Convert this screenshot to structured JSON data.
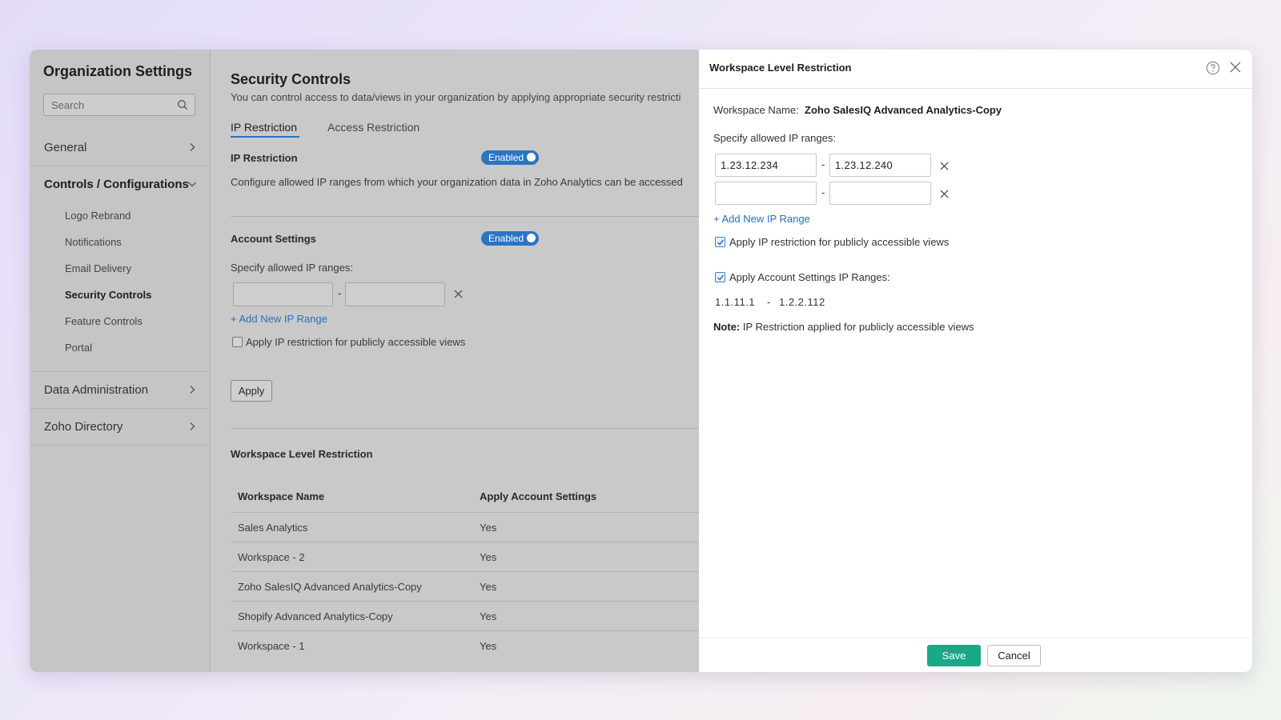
{
  "sidebar": {
    "title": "Organization Settings",
    "search_placeholder": "Search",
    "sections": {
      "general": "General",
      "controls": "Controls / Configurations",
      "data_admin": "Data Administration",
      "directory": "Zoho Directory"
    },
    "sub_items": [
      "Logo Rebrand",
      "Notifications",
      "Email Delivery",
      "Security Controls",
      "Feature Controls",
      "Portal"
    ],
    "active_sub_item": "Security Controls"
  },
  "main": {
    "title": "Security Controls",
    "description": "You can control access to data/views in your organization by applying appropriate security restricti",
    "tabs": [
      "IP Restriction",
      "Access Restriction"
    ],
    "active_tab": "IP Restriction",
    "ip_restriction": {
      "label": "IP Restriction",
      "toggle": "Enabled",
      "description": "Configure allowed IP ranges from which your organization data in Zoho Analytics can be accessed"
    },
    "account_settings": {
      "label": "Account Settings",
      "toggle": "Enabled",
      "ranges_label": "Specify allowed IP ranges:",
      "range_separator": "-",
      "add_link": "+ Add New IP Range",
      "public_views_checkbox": "Apply IP restriction for publicly accessible views",
      "public_views_checked": false,
      "apply_button": "Apply"
    },
    "workspace_table": {
      "title": "Workspace Level Restriction",
      "columns": [
        "Workspace Name",
        "Apply Account Settings"
      ],
      "rows": [
        [
          "Sales Analytics",
          "Yes"
        ],
        [
          "Workspace - 2",
          "Yes"
        ],
        [
          "Zoho SalesIQ Advanced Analytics-Copy",
          "Yes"
        ],
        [
          "Shopify Advanced Analytics-Copy",
          "Yes"
        ],
        [
          "Workspace - 1",
          "Yes"
        ]
      ]
    }
  },
  "panel": {
    "title": "Workspace Level Restriction",
    "workspace_name_label": "Workspace Name:",
    "workspace_name": "Zoho SalesIQ Advanced Analytics-Copy",
    "ranges_label": "Specify allowed IP ranges:",
    "range_separator": "-",
    "ranges": [
      {
        "from": "1.23.12.234",
        "to": "1.23.12.240"
      },
      {
        "from": "",
        "to": ""
      }
    ],
    "add_link": "+ Add New IP Range",
    "public_views_checkbox": "Apply IP restriction for publicly accessible views",
    "public_views_checked": true,
    "account_settings_checkbox": "Apply Account Settings IP Ranges:",
    "account_settings_checked": true,
    "account_range_from": "1.1.11.1",
    "account_range_sep": "-",
    "account_range_to": "1.2.2.112",
    "note_label": "Note:",
    "note_text": "IP Restriction applied for publicly accessible views",
    "save_button": "Save",
    "cancel_button": "Cancel"
  },
  "colors": {
    "accent_blue": "#2a74c4",
    "save_green": "#1aa886",
    "overlay_gray": "#c9c9c9"
  }
}
